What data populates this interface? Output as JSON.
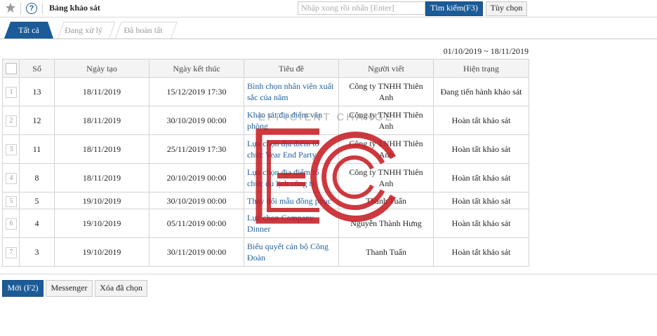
{
  "header": {
    "title": "Bảng khảo sát",
    "search_placeholder": "Nhập xong rồi nhấn [Enter]",
    "search_button": "Tìm kiếm(F3)",
    "options_button": "Tùy chọn"
  },
  "tabs": [
    {
      "label": "Tất cả",
      "active": true
    },
    {
      "label": "Đang xử lý",
      "active": false
    },
    {
      "label": "Đã hoàn tất",
      "active": false
    }
  ],
  "date_range": "01/10/2019 ~ 18/11/2019",
  "table": {
    "columns": [
      "Số",
      "Ngày tạo",
      "Ngày kết thúc",
      "Tiêu đề",
      "Người viết",
      "Hiện trạng"
    ],
    "rows": [
      {
        "idx": "1",
        "so": "13",
        "created": "18/11/2019",
        "end": "15/12/2019 17:30",
        "title": "Bình chọn nhân viên xuất sắc của năm",
        "author": "Công ty TNHH Thiên Anh",
        "status": "Đang tiến hành khảo sát"
      },
      {
        "idx": "2",
        "so": "12",
        "created": "18/11/2019",
        "end": "30/10/2019 00:00",
        "title": "Khảo sát địa điểm văn phòng",
        "author": "Công ty TNHH Thiên Anh",
        "status": "Hoàn tất khảo sát"
      },
      {
        "idx": "3",
        "so": "11",
        "created": "18/11/2019",
        "end": "25/11/2019 17:30",
        "title": "Lựa chọn địa điểm tổ chức Year End Party",
        "author": "Công ty TNHH Thiên Anh",
        "status": "Hoàn tất khảo sát"
      },
      {
        "idx": "4",
        "so": "8",
        "created": "18/11/2019",
        "end": "20/10/2019 00:00",
        "title": "Lựa chọn địa điểm tổ chức du lịch công ty",
        "author": "Công ty TNHH Thiên Anh",
        "status": "Hoàn tất khảo sát"
      },
      {
        "idx": "5",
        "so": "5",
        "created": "19/10/2019",
        "end": "30/10/2019 00:00",
        "title": "Thay đổi mẫu đồng phục",
        "author": "Thanh Tuấn",
        "status": "Hoàn tất khảo sát"
      },
      {
        "idx": "6",
        "so": "4",
        "created": "19/10/2019",
        "end": "05/11/2019 00:00",
        "title": "Lựa chọn Company Dinner",
        "author": "Nguyễn Thành Hưng",
        "status": "Hoàn tất khảo sát"
      },
      {
        "idx": "7",
        "so": "3",
        "created": "19/10/2019",
        "end": "30/11/2019 00:00",
        "title": "Biểu quyết cán bộ Công Đoàn",
        "author": "Thanh Tuấn",
        "status": "Hoàn tất khảo sát"
      }
    ]
  },
  "footer": {
    "new_button": "Mới (F2)",
    "messenger_button": "Messenger",
    "delete_button": "Xóa đã chọn"
  },
  "watermark": {
    "text": "EFFICIENT CHANGE",
    "color": "#c4161c"
  },
  "icons": {
    "favorite": "star-icon",
    "help": "help-icon"
  },
  "colors": {
    "accent": "#1a5b98",
    "link": "#1e5f9e"
  }
}
